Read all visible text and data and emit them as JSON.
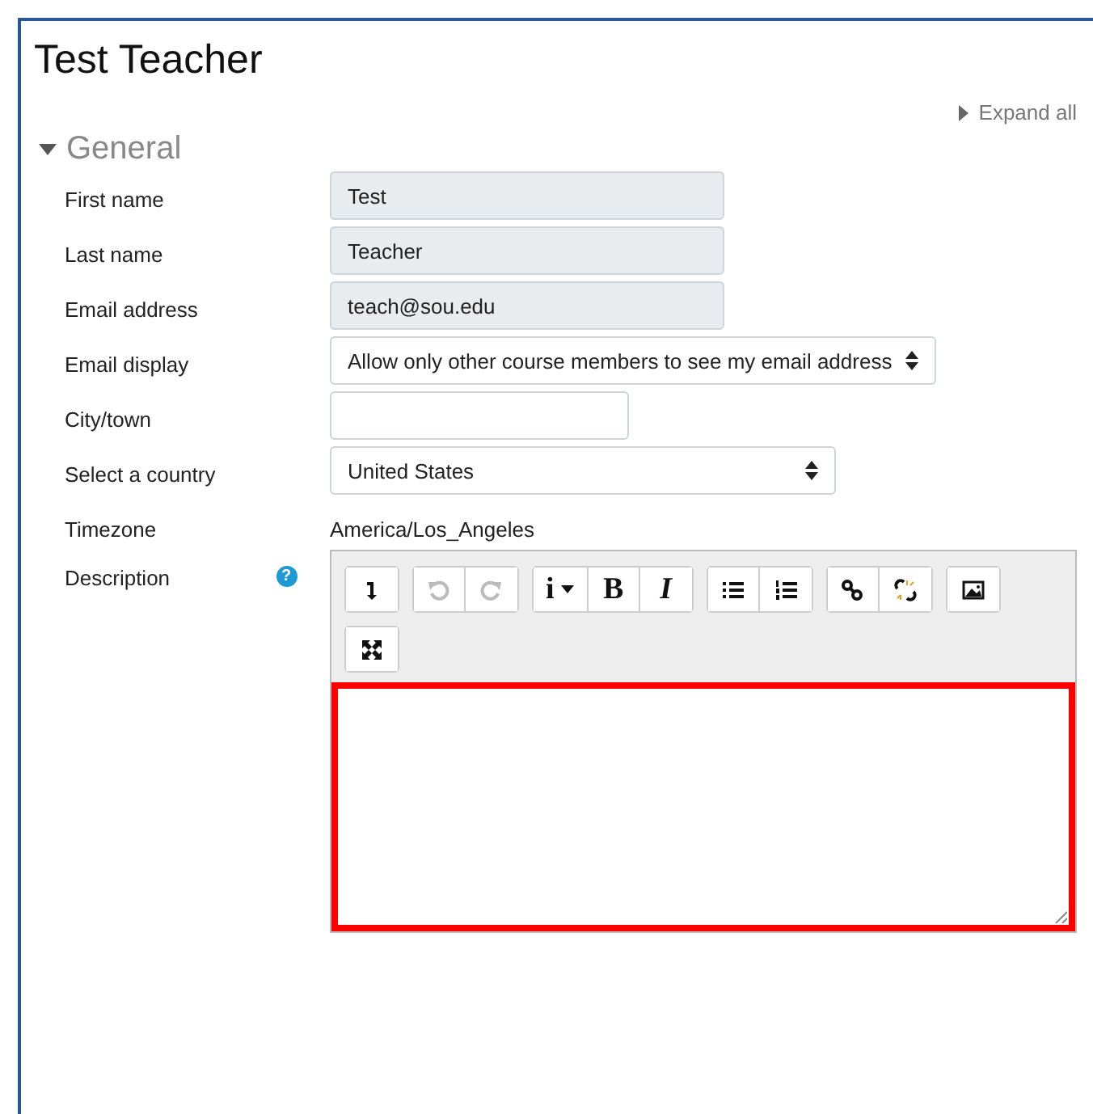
{
  "page_title": "Test Teacher",
  "expand_all": "Expand all",
  "section": {
    "title": "General",
    "expanded": true
  },
  "fields": [
    {
      "kind": "text",
      "label": "First name",
      "value": "Test",
      "disabled": true
    },
    {
      "kind": "text",
      "label": "Last name",
      "value": "Teacher",
      "disabled": true
    },
    {
      "kind": "text",
      "label": "Email address",
      "value": "teach@sou.edu",
      "disabled": true
    },
    {
      "kind": "select",
      "label": "Email display",
      "value": "Allow only other course members to see my email address"
    },
    {
      "kind": "text",
      "label": "City/town",
      "disabled": false
    },
    {
      "kind": "select",
      "label": "Select a country",
      "value": "United States"
    },
    {
      "kind": "static",
      "label": "Timezone",
      "value": "America/Los_Angeles"
    },
    {
      "kind": "editor",
      "label": "Description",
      "help": "?",
      "highlighted": true,
      "toolbar": [
        [
          {
            "kind": "collapse",
            "disabled": false
          }
        ],
        [
          {
            "kind": "undo",
            "disabled": true
          },
          {
            "kind": "redo",
            "disabled": true
          }
        ],
        [
          {
            "kind": "info",
            "label": "i",
            "dropdown": true,
            "disabled": false
          },
          {
            "kind": "bold",
            "label": "B",
            "disabled": false
          },
          {
            "kind": "italic",
            "label": "I",
            "disabled": false
          }
        ],
        [
          {
            "kind": "bullets",
            "disabled": false
          },
          {
            "kind": "numbers",
            "disabled": false
          }
        ],
        [
          {
            "kind": "link",
            "disabled": false
          },
          {
            "kind": "unlink",
            "disabled": false
          }
        ],
        [
          {
            "kind": "image",
            "disabled": false
          }
        ],
        [
          {
            "kind": "fullscreen",
            "disabled": false
          }
        ]
      ]
    }
  ]
}
